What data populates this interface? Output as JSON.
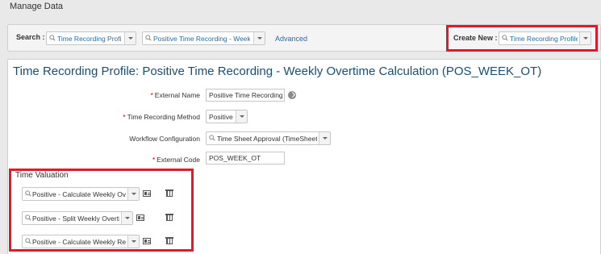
{
  "page": {
    "title": "Manage Data"
  },
  "search": {
    "label": "Search :",
    "type_value": "Time Recording Profile",
    "object_value": "Positive Time Recording - Week...",
    "advanced_link": "Advanced"
  },
  "create_new": {
    "label": "Create New :",
    "value": "Time Recording Profile"
  },
  "record": {
    "title": "Time Recording Profile: Positive Time Recording - Weekly Overtime Calculation (POS_WEEK_OT)",
    "fields": {
      "external_name": {
        "label": "External Name",
        "required": "*",
        "value": "Positive Time Recording - W"
      },
      "time_recording_method": {
        "label": "Time Recording Method",
        "required": "*",
        "value": "Positive"
      },
      "workflow_configuration": {
        "label": "Workflow Configuration",
        "value": "Time Sheet Approval (TimeSheet..."
      },
      "external_code": {
        "label": "External Code",
        "required": "*",
        "value": "POS_WEEK_OT"
      }
    }
  },
  "time_valuation": {
    "heading": "Time Valuation",
    "items": [
      {
        "value": "Positive - Calculate Weekly Ov..."
      },
      {
        "value": "Positive - Split Weekly Overti..."
      },
      {
        "value": "Positive - Calculate Weekly Re..."
      }
    ]
  },
  "colors": {
    "accent": "#1a4e78",
    "link": "#2a6ca8",
    "highlight": "#e01a2a",
    "required": "#cc0000"
  },
  "icons": [
    "magnifier-icon",
    "dropdown-arrow-icon",
    "globe-icon",
    "card-icon",
    "trash-icon"
  ]
}
